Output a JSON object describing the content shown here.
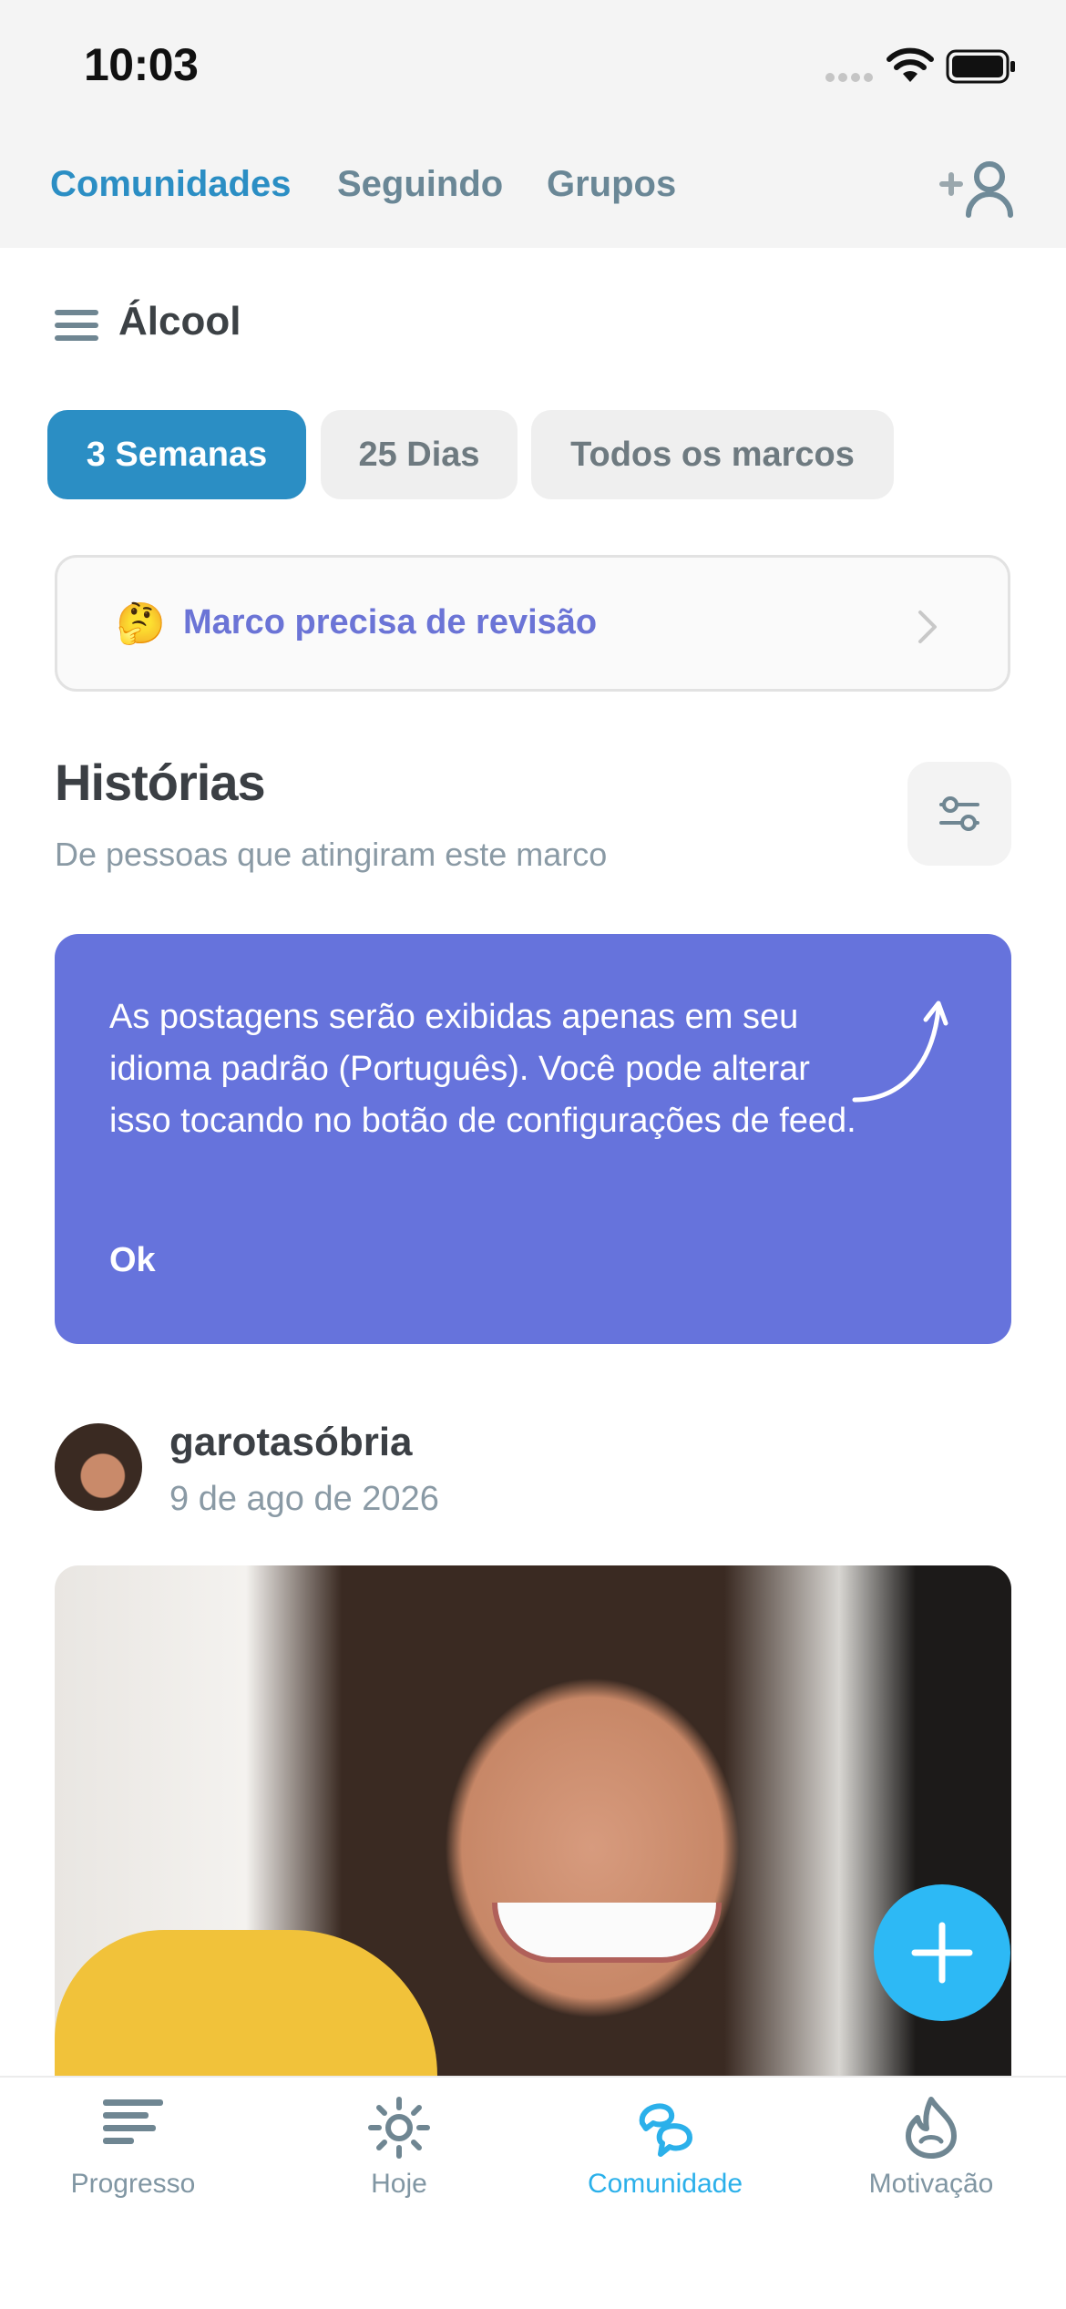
{
  "status_bar": {
    "time": "10:03"
  },
  "header": {
    "tabs": [
      {
        "label": "Comunidades",
        "active": true
      },
      {
        "label": "Seguindo",
        "active": false
      },
      {
        "label": "Grupos",
        "active": false
      }
    ],
    "add_friend_icon": "add-person-icon"
  },
  "category": {
    "title": "Álcool",
    "menu_icon": "hamburger-menu-icon"
  },
  "chips": [
    {
      "label": "3 Semanas",
      "selected": true
    },
    {
      "label": "25 Dias",
      "selected": false
    },
    {
      "label": "Todos os marcos",
      "selected": false
    }
  ],
  "review": {
    "emoji": "🤔",
    "label": "Marco precisa de revisão"
  },
  "stories": {
    "title": "Histórias",
    "subtitle": "De pessoas que atingiram este marco",
    "filter_icon": "sliders-icon"
  },
  "info_card": {
    "text": "As postagens serão exibidas apenas em seu idioma padrão (Português). Você pode alterar isso tocando no botão de configurações de feed.",
    "ok_label": "Ok"
  },
  "post": {
    "username": "garotasóbria",
    "date": "9 de ago de 2026"
  },
  "fab": {
    "icon": "plus-icon"
  },
  "bottom_nav": [
    {
      "label": "Progresso",
      "icon": "progress-bars-icon",
      "active": false
    },
    {
      "label": "Hoje",
      "icon": "sun-icon",
      "active": false
    },
    {
      "label": "Comunidade",
      "icon": "community-chat-icon",
      "active": true
    },
    {
      "label": "Motivação",
      "icon": "flame-icon",
      "active": false
    }
  ],
  "colors": {
    "accent": "#2b8ec4",
    "card": "#6673dc",
    "fab": "#2db9f5",
    "active_nav": "#2bb0ea"
  }
}
